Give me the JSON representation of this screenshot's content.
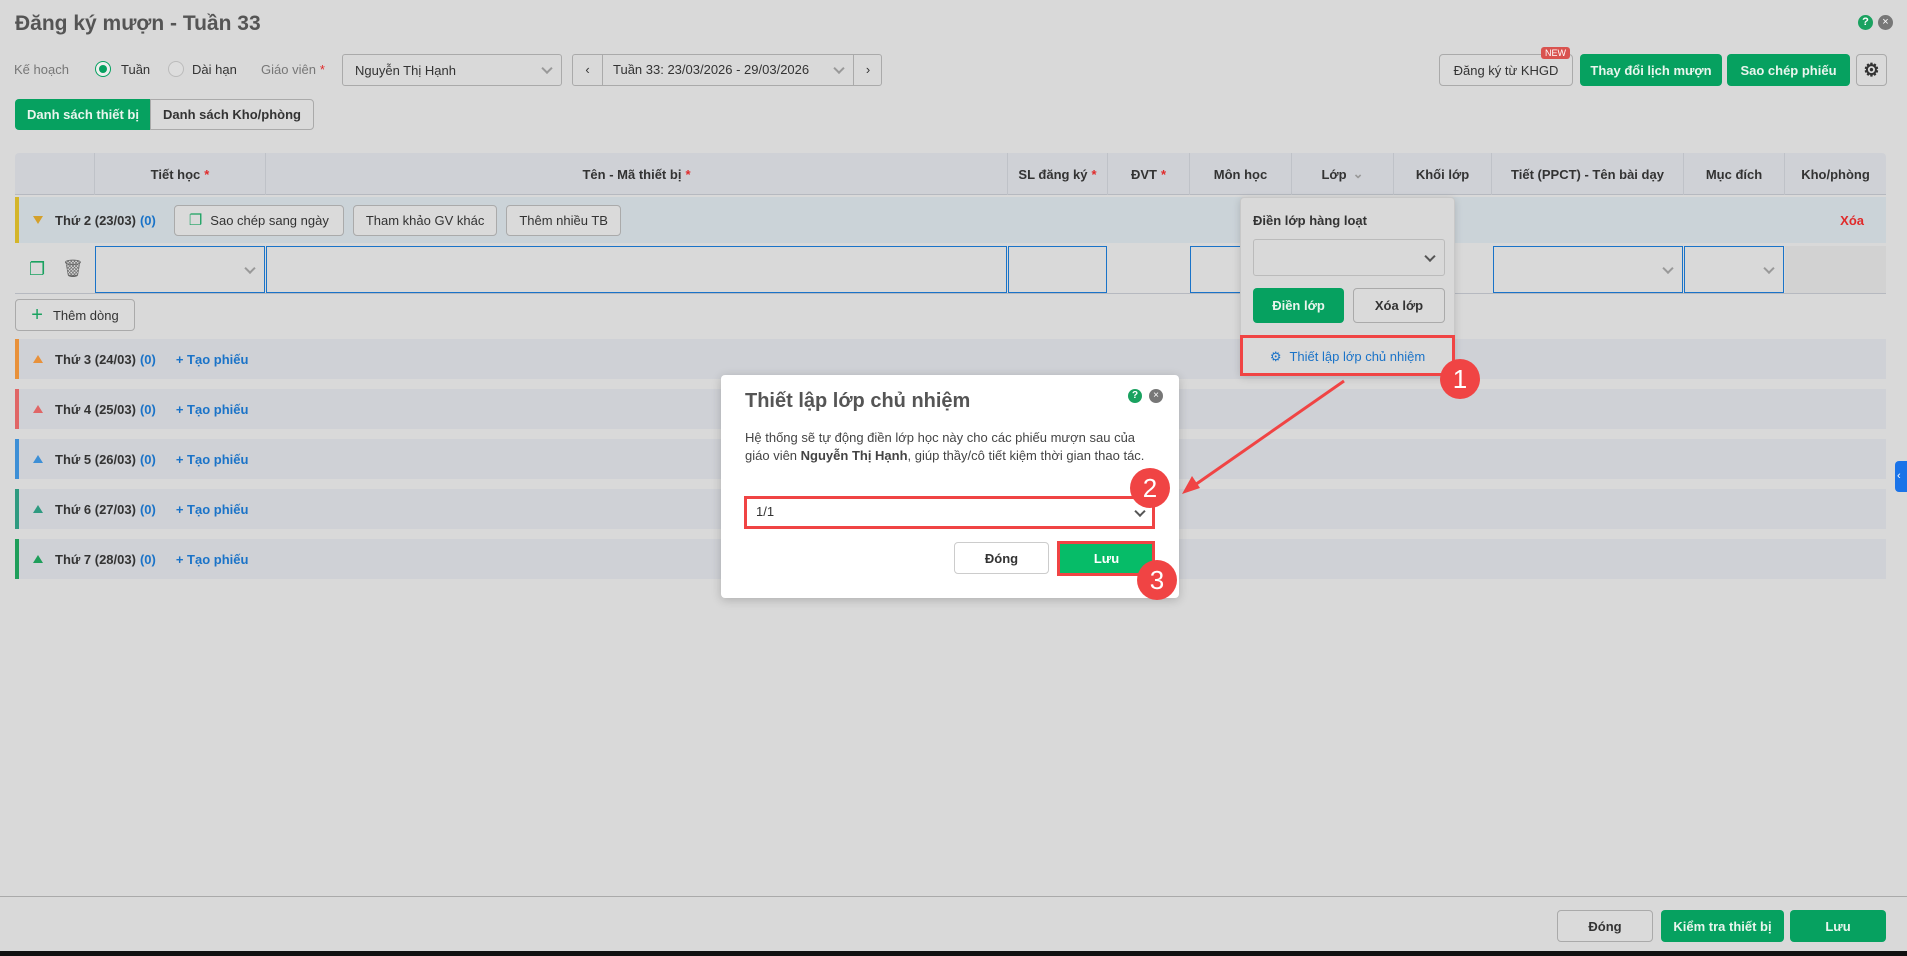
{
  "title": "Đăng ký mượn - Tuần 33",
  "filters": {
    "plan_label": "Kế hoạch",
    "radio_week": "Tuần",
    "radio_long": "Dài hạn",
    "teacher_label": "Giáo viên",
    "required": "*",
    "teacher_value": "Nguyễn Thị Hạnh",
    "week_value": "Tuần 33: 23/03/2026 - 29/03/2026"
  },
  "actions": {
    "register_khgd": "Đăng ký từ KHGD",
    "new_badge": "NEW",
    "change_schedule": "Thay đổi lịch mượn",
    "copy_ticket": "Sao chép phiếu"
  },
  "tabs": [
    "Danh sách thiết bị",
    "Danh sách Kho/phòng"
  ],
  "columns": [
    "Tiết học",
    "Tên - Mã thiết bị",
    "SL đăng ký",
    "ĐVT",
    "Môn học",
    "Lớp",
    "Khối lớp",
    "Tiết (PPCT) - Tên bài dạy",
    "Mục đích",
    "Kho/phòng"
  ],
  "day_open": {
    "label": "Thứ 2 (23/03)",
    "count": "(0)",
    "copy_btn": "Sao chép sang ngày",
    "ref_btn": "Tham khảo GV khác",
    "multi_btn": "Thêm nhiều TB",
    "delete": "Xóa"
  },
  "add_row": "Thêm dòng",
  "days": [
    {
      "label": "Thứ 3 (24/03)",
      "count": "(0)",
      "create": "+ Tạo phiếu",
      "color": "#e8913a"
    },
    {
      "label": "Thứ 4 (25/03)",
      "count": "(0)",
      "create": "+ Tạo phiếu",
      "color": "#e06666"
    },
    {
      "label": "Thứ 5 (26/03)",
      "count": "(0)",
      "create": "+ Tạo phiếu",
      "color": "#3d8fd6"
    },
    {
      "label": "Thứ 6 (27/03)",
      "count": "(0)",
      "create": "+ Tạo phiếu",
      "color": "#2e9a80"
    },
    {
      "label": "Thứ 7 (28/03)",
      "count": "(0)",
      "create": "+ Tạo phiếu",
      "color": "#1e9e5a"
    }
  ],
  "popover": {
    "title": "Điền lớp hàng loạt",
    "fill": "Điền lớp",
    "clear": "Xóa lớp",
    "setup": "Thiết lập lớp chủ nhiệm"
  },
  "dialog": {
    "title": "Thiết lập lớp chủ nhiệm",
    "text_before": "Hệ thống sẽ tự động điền lớp học này cho các phiếu mượn sau của giáo viên ",
    "teacher": "Nguyễn Thị Hạnh",
    "text_after": ", giúp thầy/cô tiết kiệm thời gian thao tác.",
    "class_value": "1/1",
    "close": "Đóng",
    "save": "Lưu"
  },
  "steps": [
    "1",
    "2",
    "3"
  ],
  "footer": {
    "close": "Đóng",
    "check": "Kiểm tra thiết bị",
    "save": "Lưu"
  }
}
